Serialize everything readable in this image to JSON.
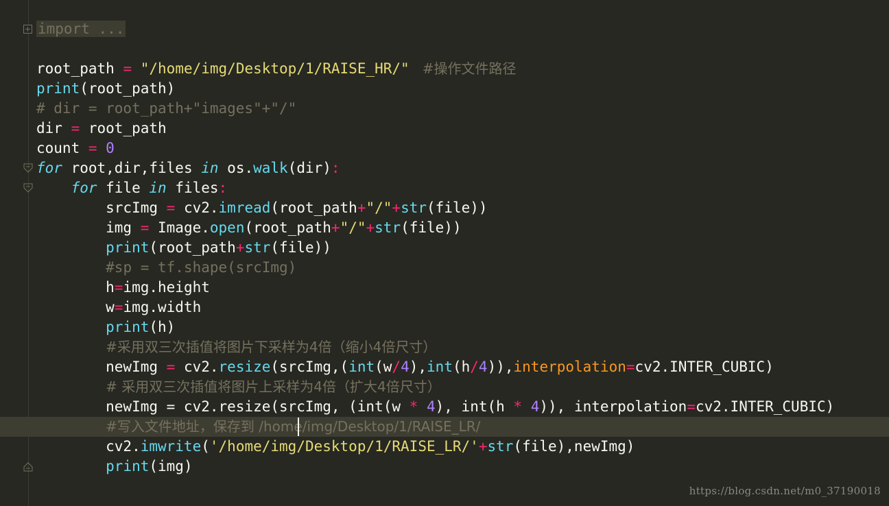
{
  "colors": {
    "background": "#272822",
    "current_line": "#3e3d32",
    "keyword": "#66d9ef",
    "string": "#e6db74",
    "operator": "#f92672",
    "number": "#ae81ff",
    "comment": "#75715e",
    "parameter": "#fd971f",
    "text": "#f8f8f2"
  },
  "icons": [
    "fold-expand-icon",
    "fold-collapse-icon",
    "fold-end-icon"
  ],
  "code": {
    "l1": {
      "folded": "import ..."
    },
    "l2": {
      "a": "root_path ",
      "b": "=",
      "c": " ",
      "d": "\"/home/img/Desktop/1/RAISE_HR/\"",
      "e": "   #操作文件路径"
    },
    "l3": {
      "a": "print",
      "b": "(root_path)"
    },
    "l4": {
      "a": "# dir = root_path+\"images\"+\"/\""
    },
    "l5": {
      "a": "dir ",
      "b": "=",
      "c": " root_path"
    },
    "l6": {
      "a": "count ",
      "b": "=",
      "c": " ",
      "d": "0"
    },
    "l7": {
      "a": "for",
      "b": " root,dir,files ",
      "c": "in",
      "d": " os.",
      "e": "walk",
      "f": "(dir)",
      "g": ":"
    },
    "l8": {
      "a": "    ",
      "b": "for",
      "c": " file ",
      "d": "in",
      "e": " files",
      "f": ":"
    },
    "l9": {
      "a": "        srcImg ",
      "b": "=",
      "c": " cv2.",
      "d": "imread",
      "e": "(root_path",
      "f": "+",
      "g": "\"/\"",
      "h": "+",
      "i": "str",
      "j": "(file))"
    },
    "l10": {
      "a": "        img ",
      "b": "=",
      "c": " Image.",
      "d": "open",
      "e": "(root_path",
      "f": "+",
      "g": "\"/\"",
      "h": "+",
      "i": "str",
      "j": "(file))"
    },
    "l11": {
      "a": "        ",
      "b": "print",
      "c": "(root_path",
      "d": "+",
      "e": "str",
      "f": "(file))"
    },
    "l12": {
      "a": "        ",
      "b": "#sp = tf.shape(srcImg)"
    },
    "l13": {
      "a": "        h",
      "b": "=",
      "c": "img.height"
    },
    "l14": {
      "a": "        w",
      "b": "=",
      "c": "img.width"
    },
    "l15": {
      "a": "        ",
      "b": "print",
      "c": "(h)"
    },
    "l16": {
      "a": "        ",
      "b": "#采用双三次插值将图片下采样为4倍（缩小4倍尺寸）"
    },
    "l17": {
      "a": "        newImg ",
      "b": "=",
      "c": " cv2.",
      "d": "resize",
      "e": "(srcImg,(",
      "f": "int",
      "g": "(w",
      "h": "/",
      "i": "4",
      "j": "),",
      "k": "int",
      "l": "(h",
      "m": "/",
      "n": "4",
      "o": ")),",
      "p": "interpolation",
      "q": "=",
      "r": "cv2.INTER_CUBIC)"
    },
    "l18": {
      "a": "        ",
      "b": "# 采用双三次插值将图片上采样为4倍（扩大4倍尺寸）"
    },
    "l19": {
      "a": "        newImg = cv2.resize(srcImg, (int(w ",
      "b": "*",
      "c": " ",
      "d": "4",
      "e": "), int(h ",
      "f": "*",
      "g": " ",
      "h": "4",
      "i": ")), interpolation",
      "j": "=",
      "k": "cv2.INTER_CUBIC)"
    },
    "l20": {
      "a": "        ",
      "b": "#写入文件地址，保存到 /home/img/Desktop/1/RAISE_LR/"
    },
    "l21": {
      "a": "        cv2.",
      "b": "imwrite",
      "c": "(",
      "d": "'/home/img/Desktop/1/RAISE_LR/'",
      "e": "+",
      "f": "str",
      "g": "(file),newImg)"
    },
    "l22": {
      "a": "        ",
      "b": "print",
      "c": "(img)"
    }
  },
  "watermark": "https://blog.csdn.net/m0_37190018"
}
